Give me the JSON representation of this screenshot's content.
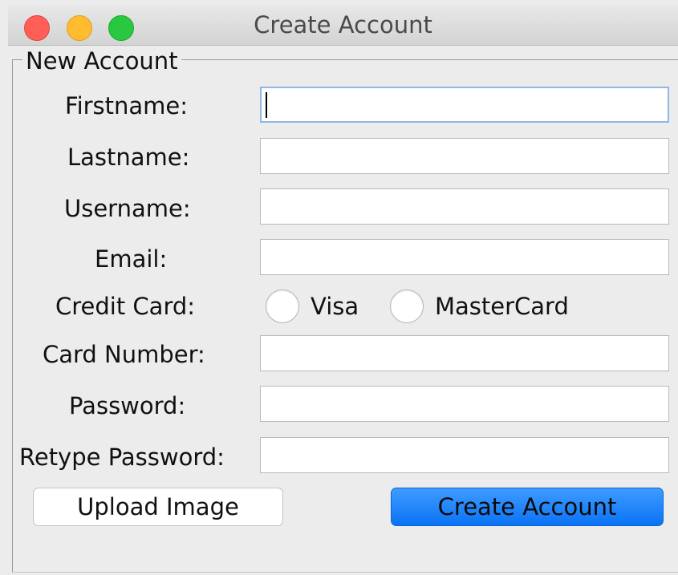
{
  "window": {
    "title": "Create Account"
  },
  "form": {
    "group_title": "New Account",
    "fields": [
      {
        "label": "Firstname:",
        "value": "",
        "focused": true
      },
      {
        "label": "Lastname:",
        "value": ""
      },
      {
        "label": "Username:",
        "value": ""
      },
      {
        "label": "Email:",
        "value": ""
      },
      {
        "label": "Card Number:",
        "value": ""
      },
      {
        "label": "Password:",
        "value": ""
      },
      {
        "label": "Retype Password:",
        "value": ""
      }
    ],
    "credit_card": {
      "label": "Credit Card:",
      "options": [
        {
          "label": "Visa",
          "selected": false
        },
        {
          "label": "MasterCard",
          "selected": false
        }
      ]
    },
    "buttons": {
      "upload": "Upload Image",
      "create": "Create Account"
    }
  },
  "colors": {
    "close": "#ff5f57",
    "minimize": "#febc2e",
    "maximize": "#28c840",
    "primary_button": "#1a7ff7",
    "focus_ring": "#8fb7e8"
  }
}
